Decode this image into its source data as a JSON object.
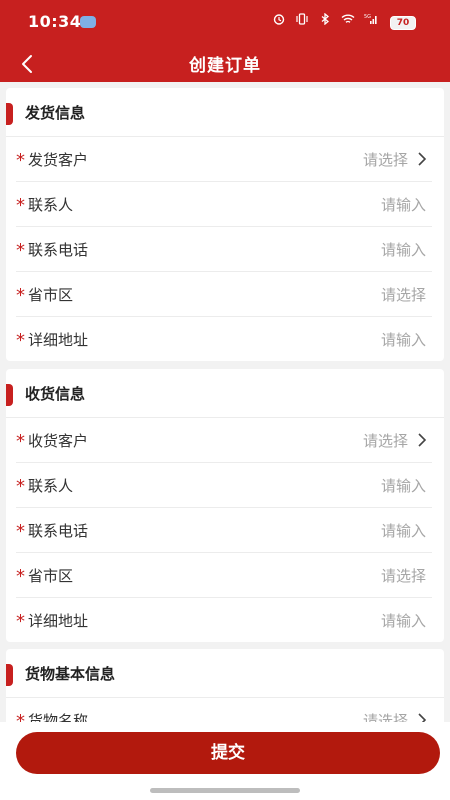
{
  "status_bar": {
    "time": "10:34",
    "battery": "70",
    "network": "5G"
  },
  "header": {
    "title": "创建订单",
    "back_icon": "chevron-left-icon"
  },
  "sections": [
    {
      "title": "发货信息",
      "fields": [
        {
          "label": "发货客户",
          "placeholder": "请选择",
          "arrow": true
        },
        {
          "label": "联系人",
          "placeholder": "请输入",
          "arrow": false
        },
        {
          "label": "联系电话",
          "placeholder": "请输入",
          "arrow": false
        },
        {
          "label": "省市区",
          "placeholder": "请选择",
          "arrow": false
        },
        {
          "label": "详细地址",
          "placeholder": "请输入",
          "arrow": false
        }
      ]
    },
    {
      "title": "收货信息",
      "fields": [
        {
          "label": "收货客户",
          "placeholder": "请选择",
          "arrow": true
        },
        {
          "label": "联系人",
          "placeholder": "请输入",
          "arrow": false
        },
        {
          "label": "联系电话",
          "placeholder": "请输入",
          "arrow": false
        },
        {
          "label": "省市区",
          "placeholder": "请选择",
          "arrow": false
        },
        {
          "label": "详细地址",
          "placeholder": "请输入",
          "arrow": false
        }
      ]
    },
    {
      "title": "货物基本信息",
      "fields": [
        {
          "label": "货物名称",
          "placeholder": "请选择",
          "arrow": true
        }
      ]
    }
  ],
  "required_mark": "*",
  "submit_label": "提交",
  "colors": {
    "brand_red": "#c7201f",
    "button_red": "#b2190d",
    "placeholder_gray": "#a6a6a6"
  }
}
